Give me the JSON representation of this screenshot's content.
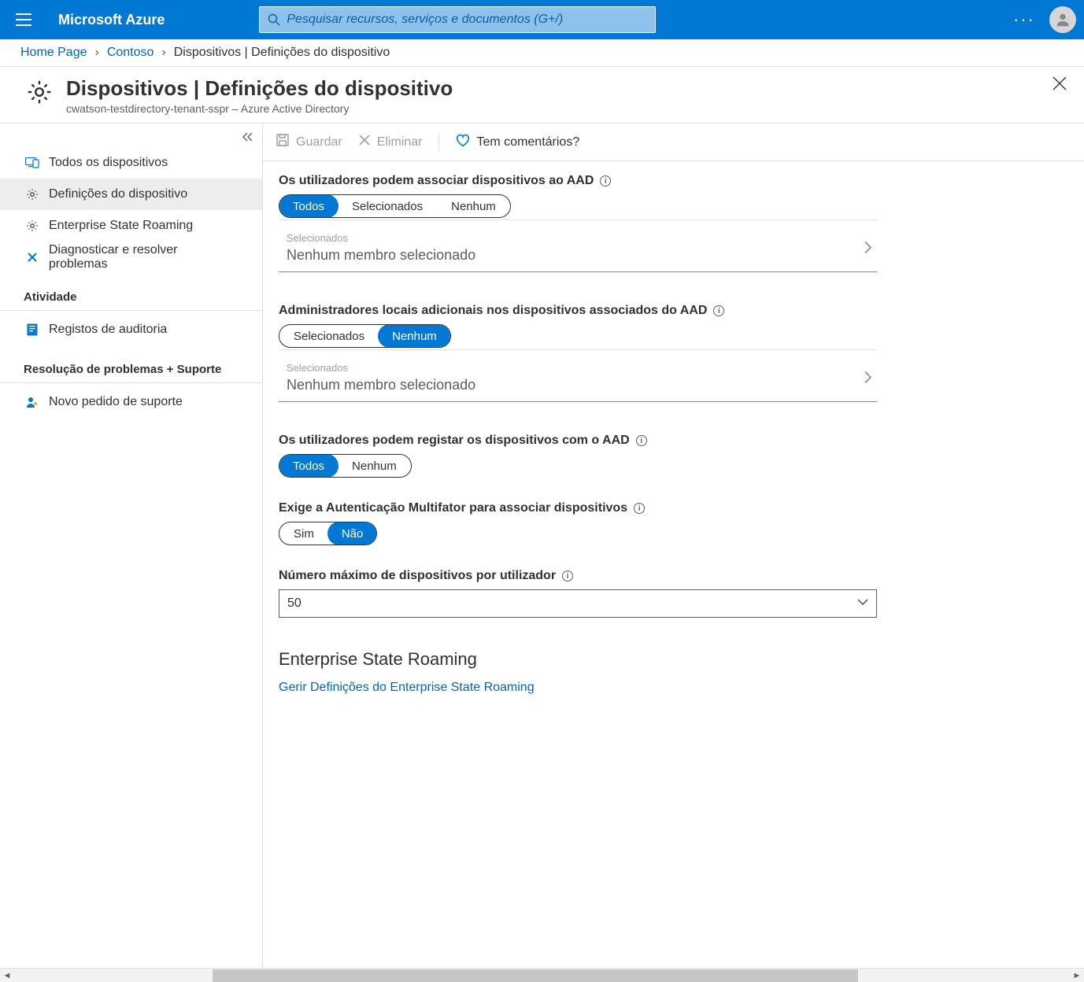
{
  "brand": "Microsoft Azure",
  "search": {
    "placeholder": "Pesquisar recursos, serviços e documentos (G+/)"
  },
  "breadcrumbs": {
    "home": "Home Page",
    "contoso": "Contoso",
    "current": "Dispositivos | Definições do dispositivo"
  },
  "blade": {
    "title": "Dispositivos | Definições do dispositivo",
    "subtitle": "cwatson-testdirectory-tenant-sspr – Azure Active Directory"
  },
  "sidenav": {
    "items": [
      {
        "label": "Todos os dispositivos"
      },
      {
        "label": "Definições do dispositivo"
      },
      {
        "label": "Enterprise State Roaming"
      },
      {
        "label": "Diagnosticar e resolver problemas"
      }
    ],
    "activityHeading": "Atividade",
    "audit": "Registos de auditoria",
    "troubleHeading": "Resolução de problemas + Suporte",
    "support": "Novo pedido de suporte"
  },
  "toolbar": {
    "save": "Guardar",
    "discard": "Eliminar",
    "feedback": "Tem comentários?"
  },
  "settings": {
    "joinAad": {
      "label": "Os utilizadores podem associar dispositivos ao AAD",
      "opts": {
        "all": "Todos",
        "selected": "Selecionados",
        "none": "Nenhum"
      },
      "picker": {
        "small": "Selecionados",
        "val": "Nenhum membro selecionado"
      }
    },
    "localAdmins": {
      "label": "Administradores locais adicionais nos dispositivos associados do AAD",
      "opts": {
        "selected": "Selecionados",
        "none": "Nenhum"
      },
      "picker": {
        "small": "Selecionados",
        "val": "Nenhum membro selecionado"
      }
    },
    "registerAad": {
      "label": "Os utilizadores podem registar os dispositivos com o AAD",
      "opts": {
        "all": "Todos",
        "none": "Nenhum"
      }
    },
    "mfa": {
      "label": "Exige a Autenticação Multifator para associar dispositivos",
      "opts": {
        "yes": "Sim",
        "no": "Não"
      }
    },
    "maxDevices": {
      "label": "Número máximo de dispositivos por utilizador",
      "value": "50"
    },
    "esrHeading": "Enterprise State Roaming",
    "esrLink": "Gerir Definições do Enterprise State Roaming"
  }
}
